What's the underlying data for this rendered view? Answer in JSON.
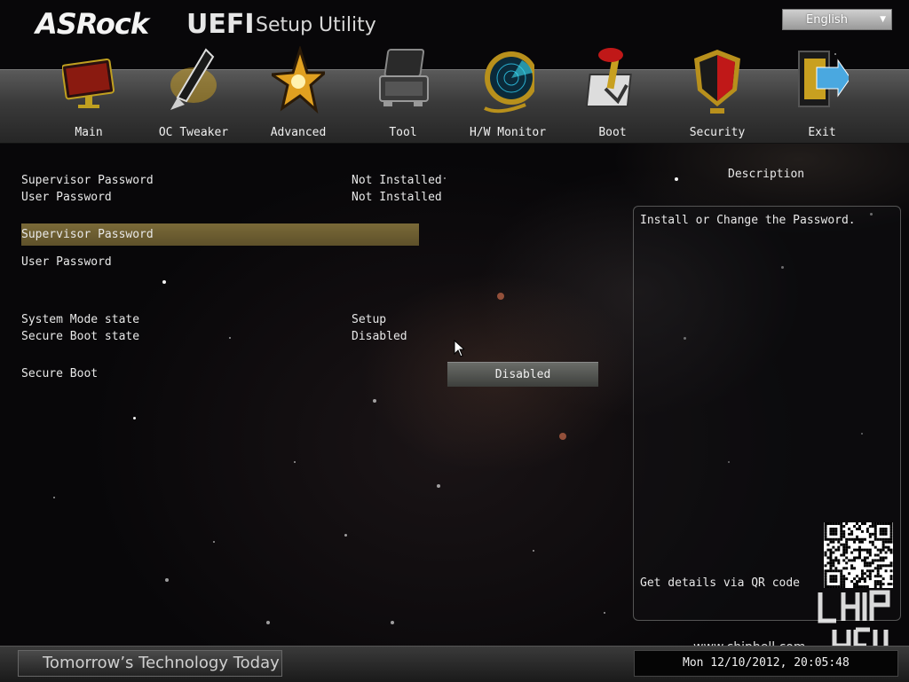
{
  "header": {
    "brand": "ASRock",
    "product": "UEFI",
    "subtitle": "Setup Utility",
    "language": "English"
  },
  "tabs": [
    {
      "label": "Main",
      "icon": "monitor-icon"
    },
    {
      "label": "OC Tweaker",
      "icon": "rocket-icon"
    },
    {
      "label": "Advanced",
      "icon": "star-icon"
    },
    {
      "label": "Tool",
      "icon": "toolbox-icon"
    },
    {
      "label": "H/W Monitor",
      "icon": "radar-icon"
    },
    {
      "label": "Boot",
      "icon": "power-switch-icon"
    },
    {
      "label": "Security",
      "icon": "shield-icon"
    },
    {
      "label": "Exit",
      "icon": "exit-door-icon"
    }
  ],
  "active_tab": "Security",
  "settings": {
    "supervisor_status_label": "Supervisor Password",
    "supervisor_status_value": "Not Installed",
    "user_status_label": "User Password",
    "user_status_value": "Not Installed",
    "supervisor_password_item": "Supervisor Password",
    "user_password_item": "User Password",
    "system_mode_label": "System Mode state",
    "system_mode_value": "Setup",
    "secure_boot_state_label": "Secure Boot state",
    "secure_boot_state_value": "Disabled",
    "secure_boot_label": "Secure Boot",
    "secure_boot_value": "Disabled"
  },
  "description": {
    "title": "Description",
    "text": "Install or Change the Password.",
    "qr_text": "Get details via QR code"
  },
  "watermark": {
    "site": "www.chiphell.com"
  },
  "footer": {
    "slogan": "Tomorrow’s Technology Today",
    "datetime": "Mon 12/10/2012, 20:05:48"
  },
  "colors": {
    "highlight": "#7a6a38",
    "menubar": "#3a3a3a",
    "background": "#0b0a0c"
  }
}
